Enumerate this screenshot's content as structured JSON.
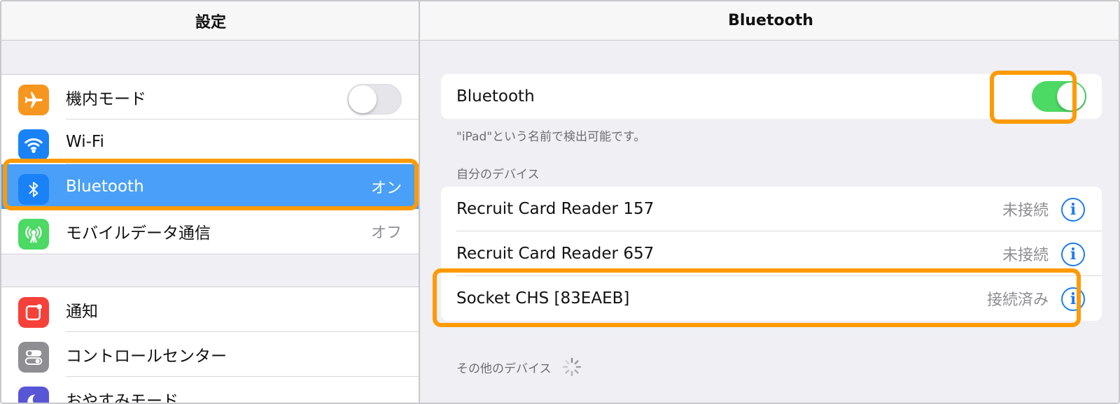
{
  "left": {
    "title": "設定",
    "group1": [
      {
        "label": "機内モード",
        "icon": "airplane-icon",
        "color": "#f7961e",
        "toggle": false
      },
      {
        "label": "Wi-Fi",
        "icon": "wifi-icon",
        "color": "#1a82f7"
      },
      {
        "label": "Bluetooth",
        "icon": "bluetooth-icon",
        "color": "#1a82f7",
        "value": "オン",
        "selected": true
      },
      {
        "label": "モバイルデータ通信",
        "icon": "cellular-icon",
        "color": "#4cd964",
        "value": "オフ"
      }
    ],
    "group2": [
      {
        "label": "通知",
        "icon": "notifications-icon",
        "color": "#f5413a"
      },
      {
        "label": "コントロールセンター",
        "icon": "control-center-icon",
        "color": "#8e8e93"
      },
      {
        "label": "おやすみモード",
        "icon": "moon-icon",
        "color": "#5856d6"
      }
    ]
  },
  "right": {
    "title": "Bluetooth",
    "bluetooth_label": "Bluetooth",
    "bluetooth_on": true,
    "discoverable_note": "\"iPad\"という名前で検出可能です。",
    "my_devices_header": "自分のデバイス",
    "devices": [
      {
        "name": "Recruit Card Reader 157",
        "status": "未接続"
      },
      {
        "name": "Recruit Card Reader 657",
        "status": "未接続"
      },
      {
        "name": "Socket CHS [83EAEB]",
        "status": "接続済み"
      }
    ],
    "other_devices_header": "その他のデバイス",
    "info_glyph": "i"
  },
  "colors": {
    "highlight": "#ff9a00",
    "selected_row": "#4aa0f8",
    "toggle_on": "#4cd964",
    "info_blue": "#1a7cf2"
  }
}
